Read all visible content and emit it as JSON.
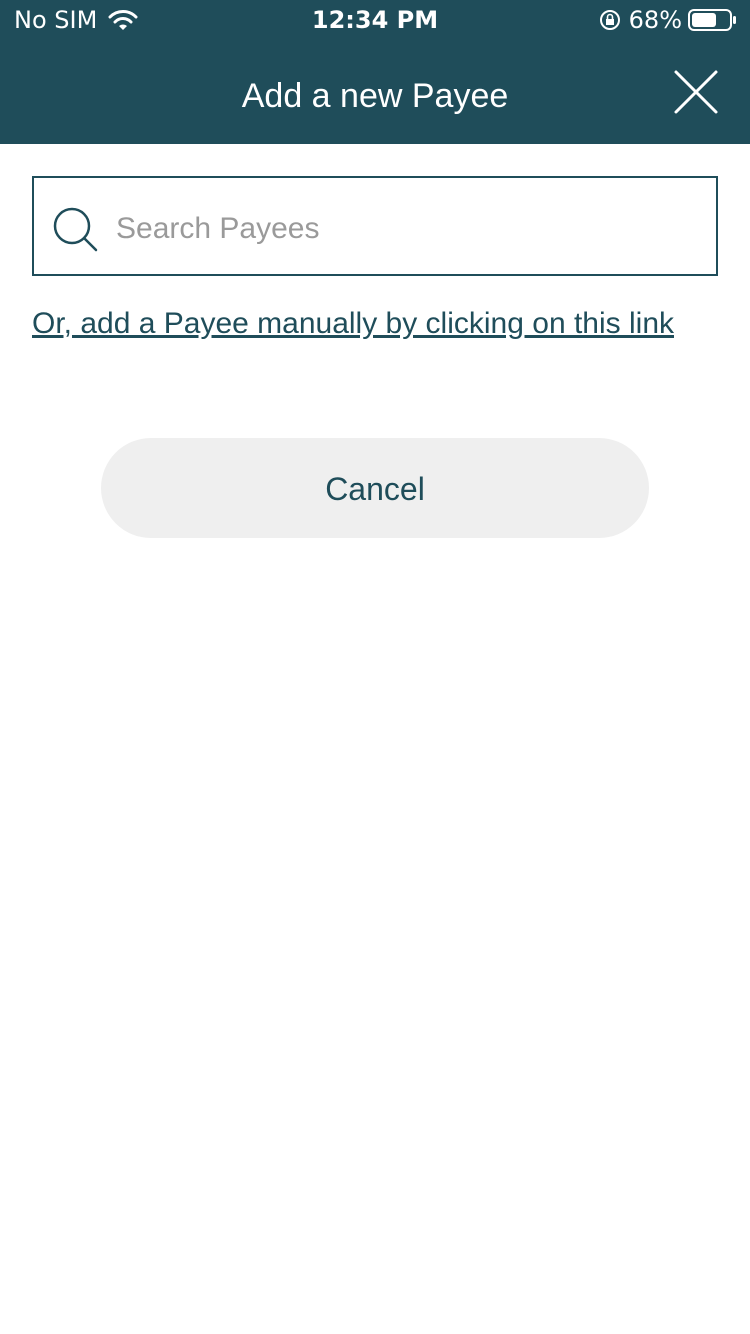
{
  "status_bar": {
    "carrier": "No SIM",
    "time": "12:34 PM",
    "battery_percent": "68%"
  },
  "header": {
    "title": "Add a new Payee",
    "close_icon": "close-icon",
    "color": "#1f4d5a"
  },
  "search": {
    "placeholder": "Search Payees",
    "value": "",
    "icon": "search-icon"
  },
  "manual_link": {
    "text": "Or, add a Payee manually by clicking on this link"
  },
  "cancel_button": {
    "label": "Cancel",
    "background": "#efefef"
  }
}
